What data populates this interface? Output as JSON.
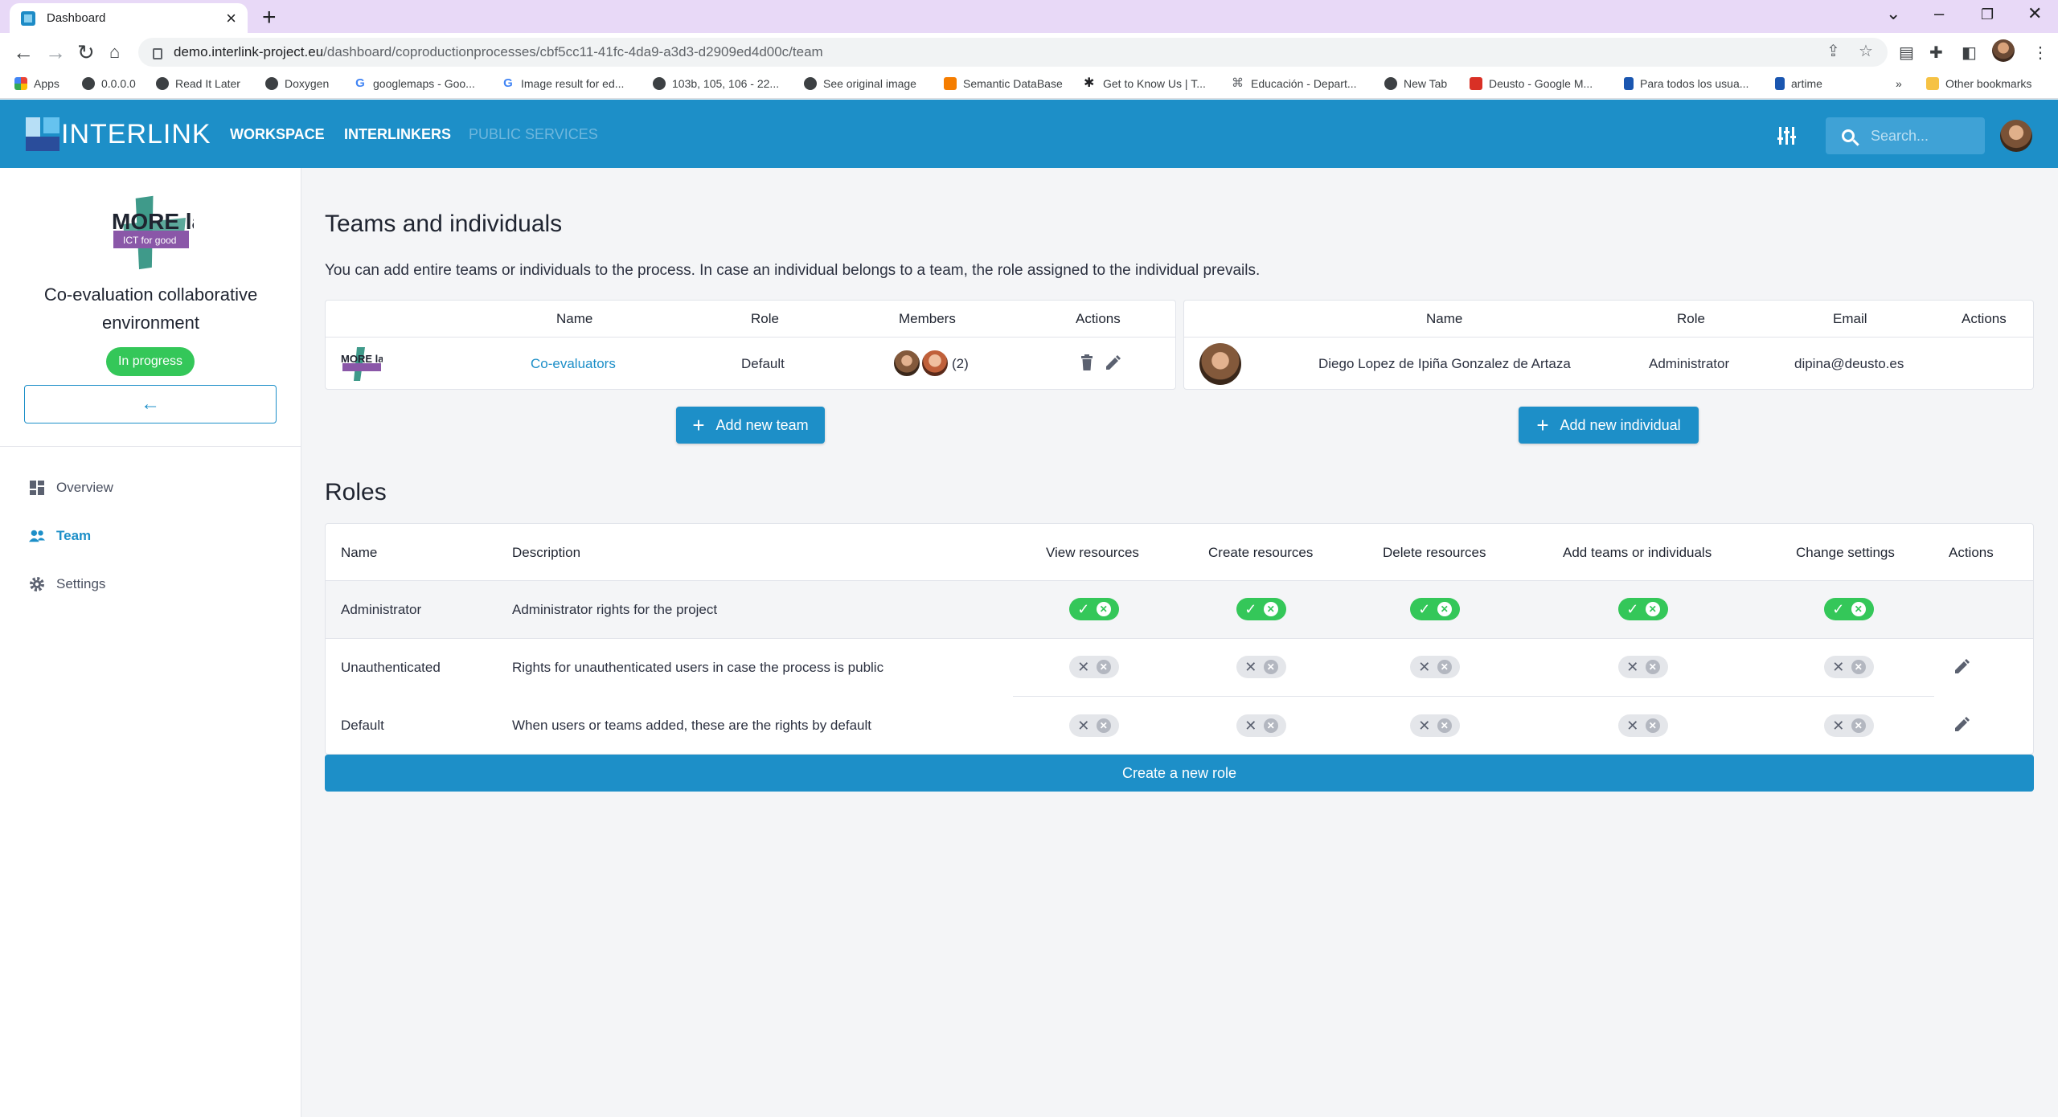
{
  "browser": {
    "tab_title": "Dashboard",
    "url_host": "demo.interlink-project.eu",
    "url_path": "/dashboard/coproductionprocesses/cbf5cc11-41fc-4da9-a3d3-d2909ed4d00c/team",
    "bookmarks": [
      {
        "label": "Apps",
        "icon": "apps-grid-icon"
      },
      {
        "label": "0.0.0.0",
        "icon": "globe-icon"
      },
      {
        "label": "Read It Later",
        "icon": "globe-icon"
      },
      {
        "label": "Doxygen",
        "icon": "globe-icon"
      },
      {
        "label": "googlemaps - Goo...",
        "icon": "google-icon"
      },
      {
        "label": "Image result for ed...",
        "icon": "google-icon"
      },
      {
        "label": "103b, 105, 106 - 22...",
        "icon": "globe-icon"
      },
      {
        "label": "See original image",
        "icon": "globe-icon"
      },
      {
        "label": "Semantic DataBase",
        "icon": "blogger-icon"
      },
      {
        "label": "Get to Know Us | T...",
        "icon": "star-icon"
      },
      {
        "label": "Educación - Depart...",
        "icon": "site-icon"
      },
      {
        "label": "New Tab",
        "icon": "globe-icon"
      },
      {
        "label": "Deusto - Google M...",
        "icon": "maps-pin-icon"
      },
      {
        "label": "Para todos los usua...",
        "icon": "doc-icon"
      },
      {
        "label": "artime",
        "icon": "doc-icon"
      }
    ],
    "bookmarks_overflow": "»",
    "other_bookmarks": "Other bookmarks"
  },
  "appbar": {
    "logo_text": "INTERLINK",
    "nav": [
      "WORKSPACE",
      "INTERLINKERS",
      "PUBLIC SERVICES"
    ],
    "search_placeholder": "Search..."
  },
  "sidebar": {
    "logo_text_top": "MORE lab",
    "logo_text_bottom": "ICT for good",
    "process_title": "Co-evaluation collaborative environment",
    "status": "In progress",
    "items": [
      {
        "label": "Overview",
        "icon": "dashboard-icon"
      },
      {
        "label": "Team",
        "icon": "people-icon"
      },
      {
        "label": "Settings",
        "icon": "gear-icon"
      }
    ]
  },
  "teams_section": {
    "title": "Teams and individuals",
    "description": "You can add entire teams or individuals to the process. In case an individual belongs to a team, the role assigned to the individual prevails.",
    "teams_table": {
      "headers": [
        "Name",
        "Role",
        "Members",
        "Actions"
      ],
      "rows": [
        {
          "name": "Co-evaluators",
          "role": "Default",
          "members_count": "(2)"
        }
      ]
    },
    "individuals_table": {
      "headers": [
        "Name",
        "Role",
        "Email",
        "Actions"
      ],
      "rows": [
        {
          "name": "Diego Lopez de Ipiña Gonzalez de Artaza",
          "role": "Administrator",
          "email": "dipina@deusto.es"
        }
      ]
    },
    "add_team_label": "Add new team",
    "add_individual_label": "Add new individual"
  },
  "roles_section": {
    "title": "Roles",
    "headers": [
      "Name",
      "Description",
      "View resources",
      "Create resources",
      "Delete resources",
      "Add teams or individuals",
      "Change settings",
      "Actions"
    ],
    "rows": [
      {
        "name": "Administrator",
        "description": "Administrator rights for the project",
        "perms": [
          true,
          true,
          true,
          true,
          true
        ],
        "editable": false
      },
      {
        "name": "Unauthenticated",
        "description": "Rights for unauthenticated users in case the process is public",
        "perms": [
          false,
          false,
          false,
          false,
          false
        ],
        "editable": true
      },
      {
        "name": "Default",
        "description": "When users or teams added, these are the rights by default",
        "perms": [
          false,
          false,
          false,
          false,
          false
        ],
        "editable": true
      }
    ],
    "create_label": "Create a new role"
  },
  "colors": {
    "primary": "#1d8fc8",
    "success": "#34c759",
    "tab_strip": "#e8d9f7"
  }
}
